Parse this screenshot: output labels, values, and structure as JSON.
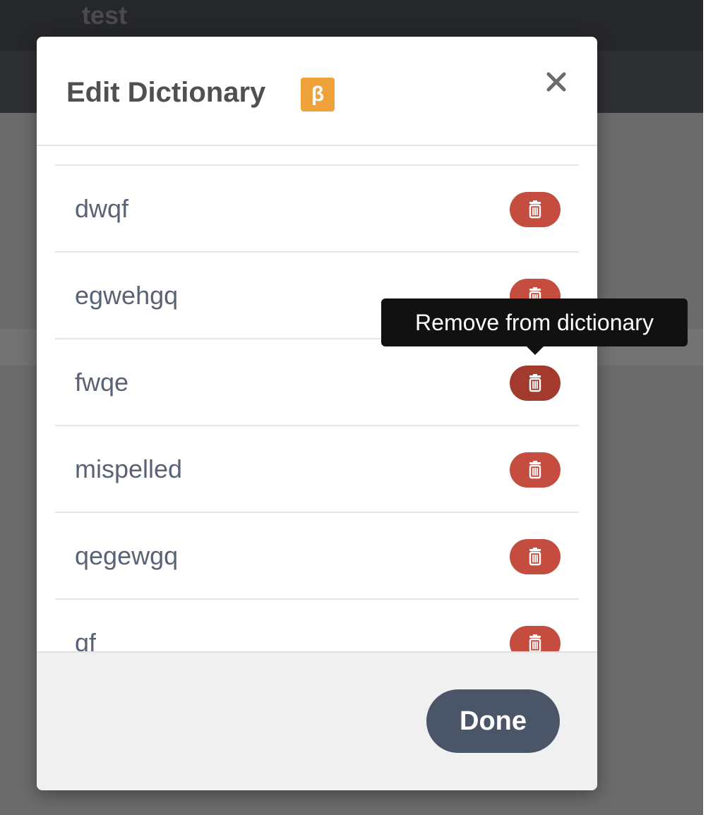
{
  "app": {
    "title": "test"
  },
  "modal": {
    "title": "Edit Dictionary",
    "beta_badge": "β",
    "close_icon": "close-icon",
    "words": [
      {
        "word": "dwqf"
      },
      {
        "word": "egwehgq"
      },
      {
        "word": "fwqe"
      },
      {
        "word": "mispelled"
      },
      {
        "word": "qegewgq"
      },
      {
        "word": "qf"
      }
    ],
    "delete_icon": "trash-icon",
    "delete_color": "#c44d40",
    "delete_hover_color": "#a33a2e",
    "tooltip": "Remove from dictionary",
    "done_label": "Done",
    "done_color": "#4a5568",
    "beta_color": "#f0a23a"
  }
}
